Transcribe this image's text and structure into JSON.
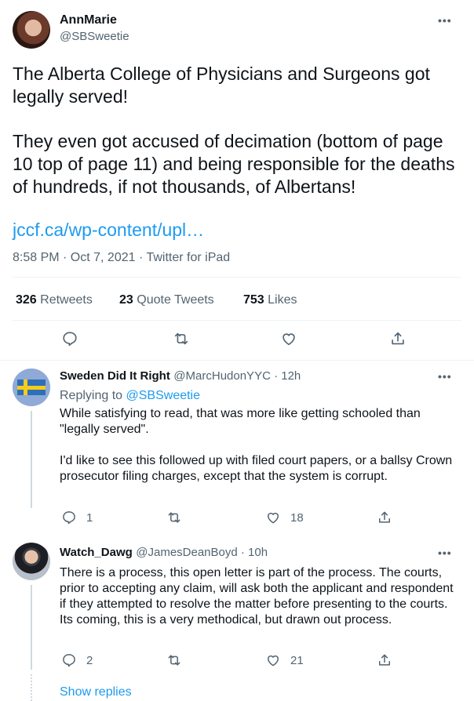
{
  "tweet": {
    "author_name": "AnnMarie",
    "author_handle": "@SBSweetie",
    "more": "•••",
    "text_p1": "The Alberta College of Physicians and Surgeons got legally served!",
    "text_p2": "They even got accused of decimation (bottom of page 10 top of page 11) and being responsible for the deaths of hundreds, if not thousands, of Albertans!",
    "link": "jccf.ca/wp-content/upl…",
    "timestamp": "8:58 PM · Oct 7, 2021 · Twitter for iPad",
    "stats": {
      "retweets_count": "326",
      "retweets_label": "Retweets",
      "quotes_count": "23",
      "quotes_label": "Quote Tweets",
      "likes_count": "753",
      "likes_label": "Likes"
    }
  },
  "replies": [
    {
      "name": "Sweden Did It Right",
      "meta": "@MarcHudonYYC · 12h",
      "replying_prefix": "Replying to",
      "replying_to": "@SBSweetie",
      "text": "While satisfying to read, that was more like getting schooled than \"legally served\".\n\nI'd like to see this followed up with filed court papers, or a ballsy Crown prosecutor filing charges, except that the system is corrupt.",
      "reply_count": "1",
      "retweet_count": "",
      "like_count": "18"
    },
    {
      "name": "Watch_Dawg",
      "meta": "@JamesDeanBoyd · 10h",
      "text": "There is a process, this open letter is part of the process. The courts, prior to accepting any claim, will ask both the applicant and respondent if they attempted to resolve the matter before presenting to the courts. Its coming, this is a very methodical, but drawn out process.",
      "reply_count": "2",
      "retweet_count": "",
      "like_count": "21"
    }
  ],
  "show_replies": "Show replies",
  "colors": {
    "accent": "#1d9bf0",
    "text": "#0f1419",
    "secondary": "#536471",
    "divider": "#eff3f4"
  }
}
